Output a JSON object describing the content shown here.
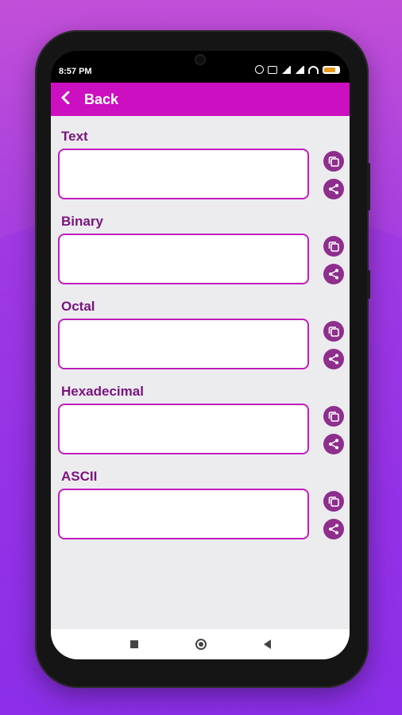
{
  "status": {
    "time": "8:57 PM"
  },
  "appbar": {
    "back_label": "Back"
  },
  "fields": [
    {
      "label": "Text",
      "value": ""
    },
    {
      "label": "Binary",
      "value": ""
    },
    {
      "label": "Octal",
      "value": ""
    },
    {
      "label": "Hexadecimal",
      "value": ""
    },
    {
      "label": "ASCII",
      "value": ""
    }
  ],
  "icons": {
    "back": "chevron-left-icon",
    "copy": "copy-icon",
    "share": "share-icon"
  },
  "colors": {
    "appbar": "#cc0fc0",
    "label": "#7a1580",
    "field_border": "#c21bbd",
    "action_button": "#8e2e8d"
  }
}
